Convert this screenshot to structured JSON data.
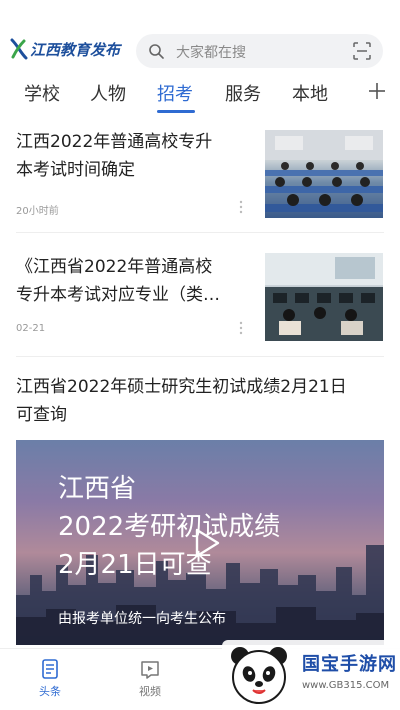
{
  "header": {
    "logo_text": "江西教育发布",
    "search_placeholder": "大家都在搜"
  },
  "tabs": [
    {
      "label": "学校",
      "active": false
    },
    {
      "label": "人物",
      "active": false
    },
    {
      "label": "招考",
      "active": true
    },
    {
      "label": "服务",
      "active": false
    },
    {
      "label": "本地",
      "active": false
    }
  ],
  "news": [
    {
      "title_line1": "江西2022年普通高校专升",
      "title_line2": "本考试时间确定",
      "meta": "20小时前"
    },
    {
      "title_line1": "《江西省2022年普通高校",
      "title_line2": "专升本考试对应专业（类…",
      "meta": "02-21"
    }
  ],
  "video_news": {
    "title_line1": "江西省2022年硕士研究生初试成绩2月21日",
    "title_line2": "可查询",
    "overlay_line1": "江西省",
    "overlay_line2": "2022考研初试成绩",
    "overlay_line3": "2月21日可查",
    "overlay_caption": "由报考单位统一向考生公布"
  },
  "bottom_nav": [
    {
      "label": "头条",
      "active": true
    },
    {
      "label": "视频",
      "active": false
    }
  ],
  "watermark": {
    "title": "国宝手游网",
    "url": "www.GB315.COM"
  },
  "colors": {
    "accent": "#2f6bd2",
    "logo": "#1d4f9c",
    "text": "#222222",
    "meta": "#999999"
  }
}
